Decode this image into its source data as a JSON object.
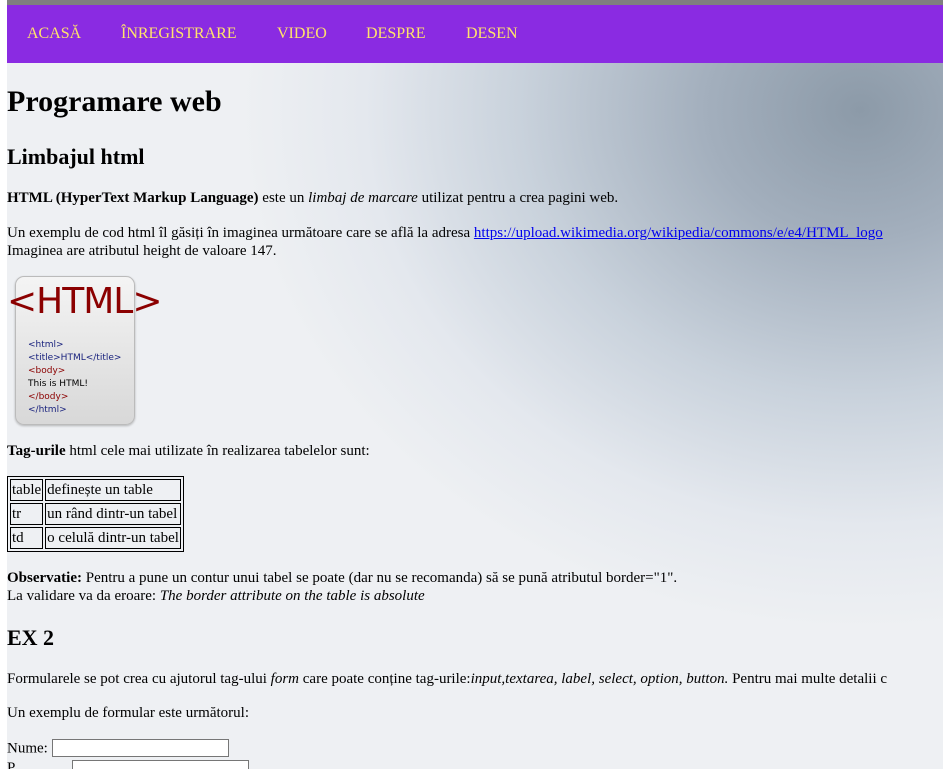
{
  "nav": {
    "items": [
      "ACASĂ",
      "ÎNREGISTRARE",
      "VIDEO",
      "DESPRE",
      "DESEN"
    ]
  },
  "page": {
    "title": "Programare web",
    "section1": {
      "heading": "Limbajul html",
      "p1_bold": "HTML (HyperText Markup Language)",
      "p1_text1": " este un ",
      "p1_italic": "limbaj de marcare",
      "p1_text2": " utilizat pentru a crea pagini web.",
      "p2_text": "Un exemplu de cod html îl găsiți în imaginea următoare care se află la adresa ",
      "p2_link": "https://upload.wikimedia.org/wikipedia/commons/e/e4/HTML_logo",
      "p2_line2": "Imaginea are atributul height de valoare 147."
    },
    "image": {
      "big_text": "<HTML>",
      "code_lines": [
        "<html>",
        "<title>HTML</title>",
        "<body>",
        "This is HTML!",
        "</body>",
        "</html>"
      ]
    },
    "tags_intro_bold": "Tag-urile",
    "tags_intro_text": " html cele mai utilizate în realizarea tabelelor sunt:",
    "table": [
      {
        "tag": "table",
        "desc": "definește un table"
      },
      {
        "tag": "tr",
        "desc": "un rând dintr-un tabel"
      },
      {
        "tag": "td",
        "desc": "o celulă dintr-un tabel"
      }
    ],
    "obs_bold": "Observatie:",
    "obs_text": " Pentru a pune un contur unui tabel se poate (dar nu se recomanda) să se pună atributul border=\"1\".",
    "obs_line2_text": "La validare va da eroare: ",
    "obs_line2_italic": "The border attribute on the table is absolute",
    "section2": {
      "heading": "EX 2",
      "p1_text1": "Formularele se pot crea cu ajutorul tag-ului ",
      "p1_italic1": "form",
      "p1_text2": " care poate conține tag-urile:",
      "p1_italic2": "input,textarea, label, select, option, button.",
      "p1_text3": " Pentru mai multe detalii c",
      "p2_text": "Un exemplu de formular este următorul:",
      "form": {
        "nume_label": "Nume:",
        "nume_value": "",
        "second_label": "P",
        "second_value": ""
      }
    }
  }
}
